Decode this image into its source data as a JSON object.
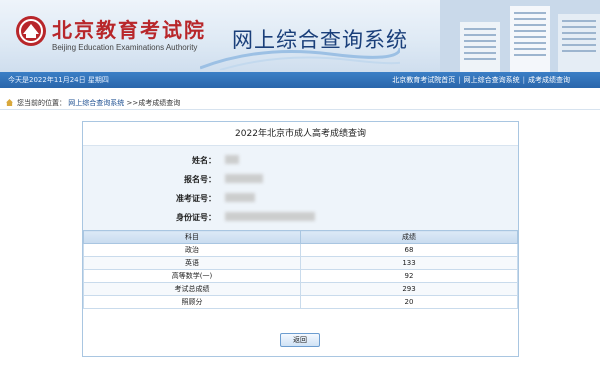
{
  "header": {
    "org_name_cn": "北京教育考试院",
    "org_name_en": "Beijing Education Examinations Authority",
    "system_title": "网上综合查询系统"
  },
  "topbar": {
    "today": "今天是2022年11月24日 星期四",
    "links": [
      "北京教育考试院首页",
      "网上综合查询系统",
      "成考成绩查询"
    ]
  },
  "breadcrumb": {
    "prefix": "您当前的位置：",
    "home": "网上综合查询系统",
    "current": ">>成考成绩查询"
  },
  "result": {
    "title": "2022年北京市成人高考成绩查询",
    "fields": [
      {
        "label": "姓名："
      },
      {
        "label": "报名号："
      },
      {
        "label": "准考证号："
      },
      {
        "label": "身份证号："
      }
    ],
    "columns": [
      "科目",
      "成绩"
    ],
    "rows": [
      {
        "subject": "政治",
        "score": "68"
      },
      {
        "subject": "英语",
        "score": "133"
      },
      {
        "subject": "高等数学(一)",
        "score": "92"
      },
      {
        "subject": "考试总成绩",
        "score": "293"
      },
      {
        "subject": "照顾分",
        "score": "20"
      }
    ],
    "back_label": "返回"
  },
  "colors": {
    "accent": "#2a66ab",
    "logo_red": "#b8262a",
    "title_blue": "#1a3f7a",
    "panel_border": "#a9c6e1"
  }
}
